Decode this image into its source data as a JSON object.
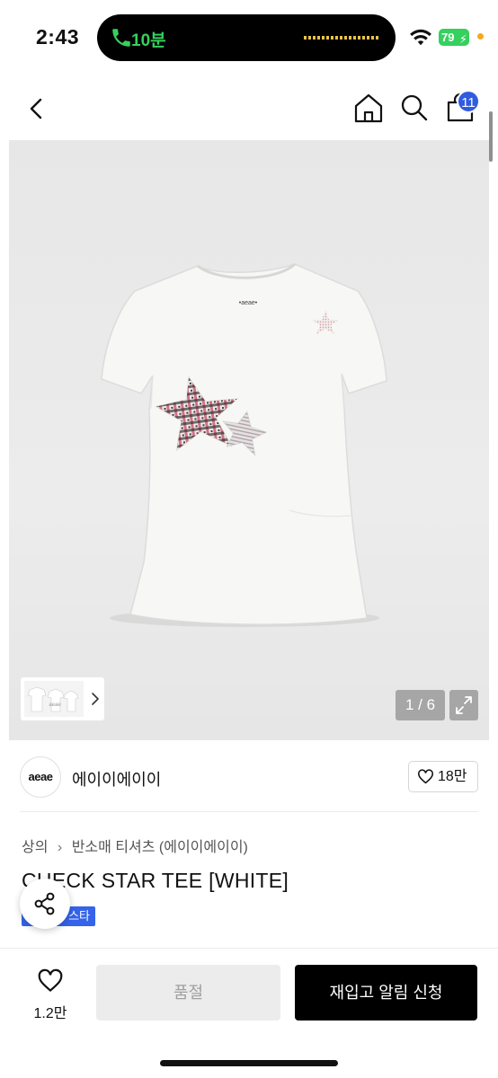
{
  "status_bar": {
    "time": "2:43",
    "call_duration": "10분",
    "battery": "79",
    "accent_green": "#35d05e"
  },
  "header": {
    "back_icon": "chevron-left-icon",
    "home_icon": "home-icon",
    "search_icon": "search-icon",
    "cart_icon": "shopping-bag-icon",
    "cart_count": "11",
    "badge_color": "#2f5ce0"
  },
  "gallery": {
    "page_counter": "1 / 6",
    "expand_icon": "expand-icon",
    "thumb_arrow_icon": "chevron-right-icon",
    "main_image": "white t-shirt with star patches"
  },
  "brand": {
    "logo_text": "aeae",
    "name": "에이이에이이",
    "likes": "18만"
  },
  "product": {
    "breadcrumb": [
      "상의",
      "반소매 티셔츠 (에이이에이이)"
    ],
    "title": "CHECK STAR TEE [WHITE]",
    "tag": "스타",
    "tag_color": "#3563e9"
  },
  "share": {
    "icon": "share-icon"
  },
  "bottom_bar": {
    "wish_count": "1.2만",
    "soldout_label": "품절",
    "restock_label": "재입고 알림 신청"
  }
}
